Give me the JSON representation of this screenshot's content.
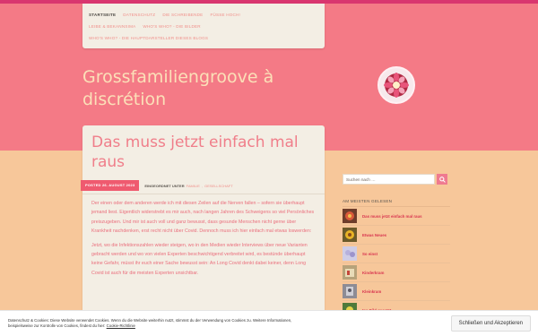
{
  "colors": {
    "header_bg": "#f47a86",
    "page_bg": "#f7c79a",
    "top_line": "#d9366f",
    "card_bg": "#f3eee4",
    "accent": "#ef5a6f",
    "link": "#d8344f"
  },
  "nav": {
    "row1": [
      "Startseite",
      "Datenschutz",
      "Die Schreibende",
      "Füße hoch!"
    ],
    "row2": [
      "Leibe & Bekannsima",
      "Who's who? - Die Bilder"
    ],
    "row3": [
      "Who's who? - Die Hauptdarsteller dieses Blogs"
    ]
  },
  "site": {
    "title": "Grossfamiliengroove à discrétion"
  },
  "post": {
    "title": "Das muss jetzt einfach mal raus",
    "date": "Posted 26. August 2023",
    "filed_label": "Eingeordnet unter",
    "categories": [
      "Familie",
      "Gesellschaft"
    ],
    "paragraphs": [
      "Der einen oder dem anderen werde ich mit diesen Zeilen auf die Nerven fallen – sofern sie überhaupt jemand liest. Eigentlich widerstrebt es mir auch, nach langen Jahren des Schweigens so viel Persönliches preiszugeben. Und mir ist auch voll und ganz bewusst, dass gesunde Menschen nicht gerne über Krankheit nachdenken, erst recht nicht über Covid. Dennoch muss ich hier einfach mal etwas loswerden:",
      "Jetzt, wo die Infektionszahlen wieder steigen, wo in den Medien wieder Interviews über neue Varianten gebracht werden und wo von vielen Experten beschwichtigend verbreitet wird, es bestünde überhaupt keine Gefahr, müsst ihr euch einer Sache bewusst sein: An Long Covid denkt dabei keiner, denn Long Covid ist auch für die meisten Experten unsichtbar."
    ]
  },
  "sidebar": {
    "search_placeholder": "Suchen nach …",
    "search_icon": "magnifier-icon",
    "popular_title": "Am meisten gelesen",
    "popular_items": [
      "Das muss jetzt einfach mal raus",
      "Etwas Neues",
      "So einst",
      "Kinderkram",
      "Kleinkram",
      "Ins Bild gesetzt"
    ]
  },
  "cookie": {
    "text": "Datenschutz & Cookies: Diese Website verwendet Cookies. Wenn du die Website weiterhin nutzt, stimmst du der Verwendung von Cookies zu. Weitere Informationen, beispielsweise zur Kontrolle von Cookies, findest du hier:",
    "link": "Cookie-Richtlinie",
    "button": "Schließen und Akzeptieren"
  }
}
